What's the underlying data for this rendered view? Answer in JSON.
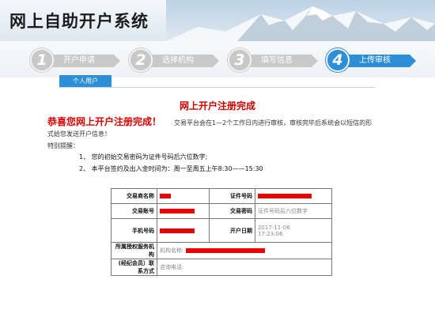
{
  "header": {
    "title": "网上自助开户系统"
  },
  "steps": [
    {
      "num": "1",
      "label": "开户申请"
    },
    {
      "num": "2",
      "label": "选择机构"
    },
    {
      "num": "3",
      "label": "填写信息"
    },
    {
      "num": "4",
      "label": "上传审核"
    }
  ],
  "tab": {
    "label": "个人用户"
  },
  "content": {
    "done_title": "网上开户注册完成",
    "congrats": "恭喜您网上开户注册完成！",
    "notice_line1": "交易平台会在1—2个工作日内进行审核，审核完毕后系统会以短信的形",
    "notice_line2": "式给您发送开户信息！",
    "tips_heading": "特别提醒：",
    "tips": [
      "1、 您的初始交易密码为证件号码后六位数字;",
      "2、 本平台签约及出入金时间为：周一至周五上午8:30——15:30"
    ]
  },
  "table": {
    "trader_name_label": "交易商名称",
    "id_number_label": "证件号码",
    "account_label": "交易账号",
    "password_label": "交易密码",
    "password_value": "证件号码后六位数字",
    "phone_label": "手机号码",
    "open_date_label": "开户日期",
    "open_date_value": "2017-11-06",
    "open_time_value": "17:23:06",
    "org_label": "所属授权服务机构",
    "org_name_label": "机构名称:",
    "contact_label": "(经纪会员）联系方式",
    "phone_contact_label": "咨询电话:"
  }
}
